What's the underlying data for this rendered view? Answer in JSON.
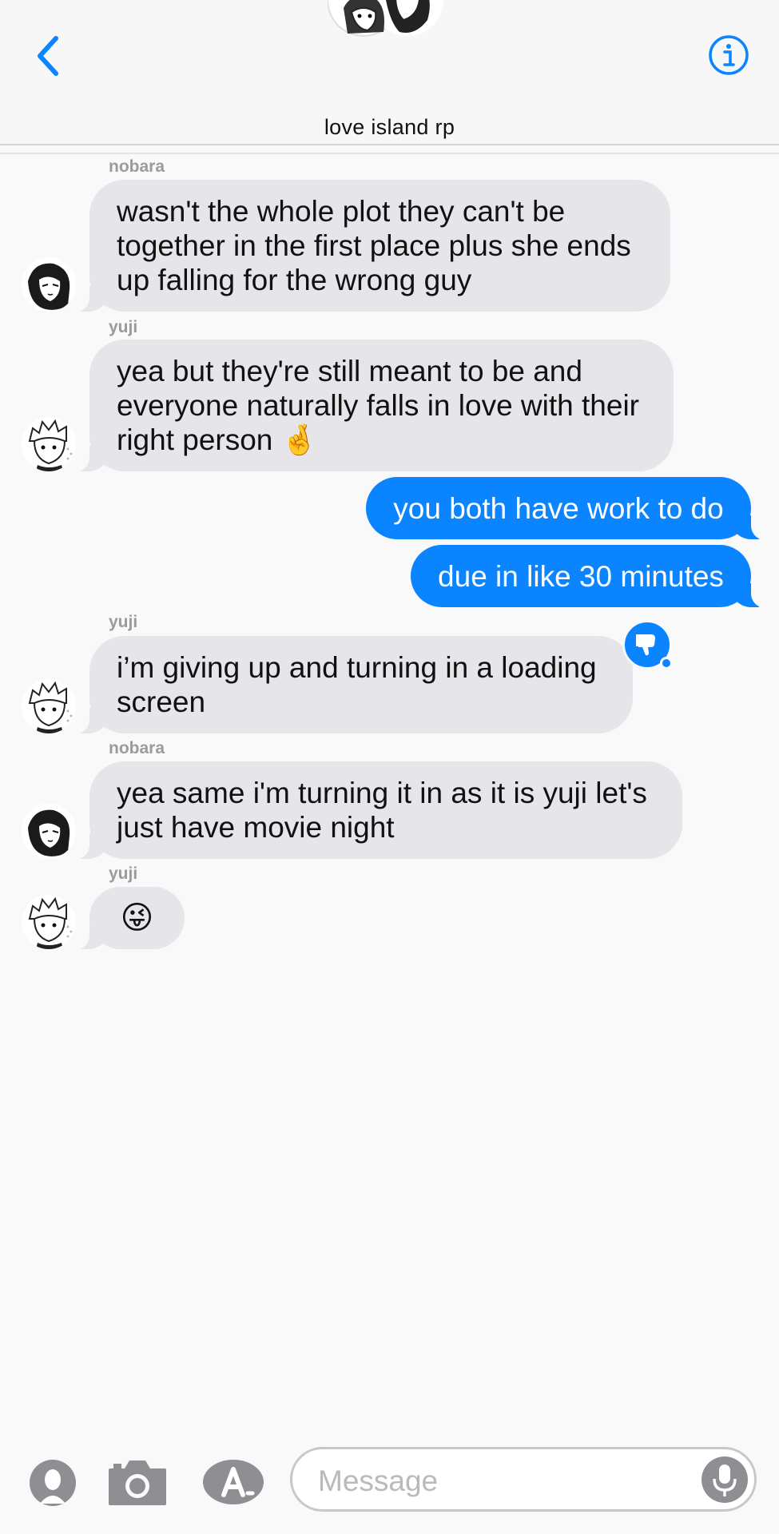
{
  "header": {
    "title": "love island rp",
    "back_icon": "chevron-left-icon",
    "info_icon": "info-icon",
    "accent": "#0a84ff"
  },
  "messages": [
    {
      "sender": "nobara",
      "direction": "incoming",
      "text": "wasn't the whole plot they can't be together in the first place plus she ends up falling for the wrong guy"
    },
    {
      "sender": "yuji",
      "direction": "incoming",
      "text": "yea but they're still meant to be and everyone naturally falls in love with their right person",
      "emoji": "🤞"
    },
    {
      "direction": "outgoing",
      "text": "you both have work to do"
    },
    {
      "direction": "outgoing",
      "text": "due in like 30 minutes"
    },
    {
      "sender": "yuji",
      "direction": "incoming",
      "text": "i’m giving up and turning in a loading screen",
      "tapback": "thumbs-down-icon"
    },
    {
      "sender": "nobara",
      "direction": "incoming",
      "text": "yea same i'm turning it in as it is yuji let's just have movie night"
    },
    {
      "sender": "yuji",
      "direction": "incoming",
      "emoji": "😜"
    }
  ],
  "input_bar": {
    "placeholder": "Message",
    "icons": [
      "memoji-icon",
      "camera-icon",
      "app-store-icon",
      "microphone-icon"
    ]
  },
  "colors": {
    "incoming_bubble": "#e5e5ea",
    "outgoing_bubble": "#0a84ff",
    "sender_label": "#9a9a9f"
  }
}
